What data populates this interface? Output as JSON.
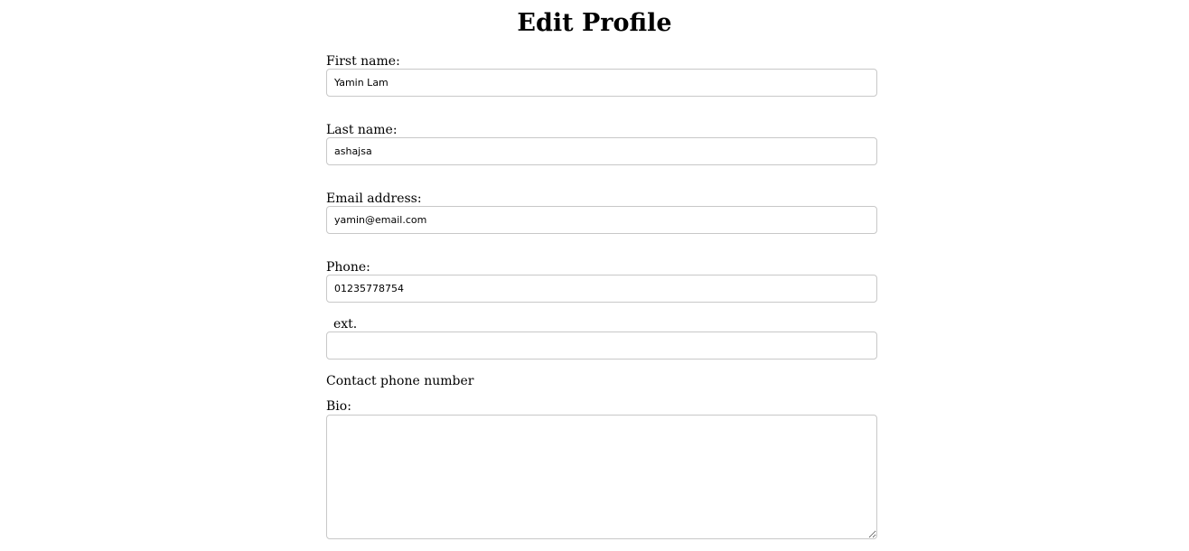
{
  "page": {
    "title": "Edit Profile"
  },
  "form": {
    "first_name": {
      "label": "First name:",
      "value": "Yamin Lam"
    },
    "last_name": {
      "label": "Last name:",
      "value": "ashajsa"
    },
    "email": {
      "label": "Email address:",
      "value": "yamin@email.com"
    },
    "phone": {
      "label": "Phone:",
      "value": "01235778754"
    },
    "ext": {
      "label": "ext.",
      "value": ""
    },
    "phone_help": "Contact phone number",
    "bio": {
      "label": "Bio:",
      "value": ""
    }
  }
}
